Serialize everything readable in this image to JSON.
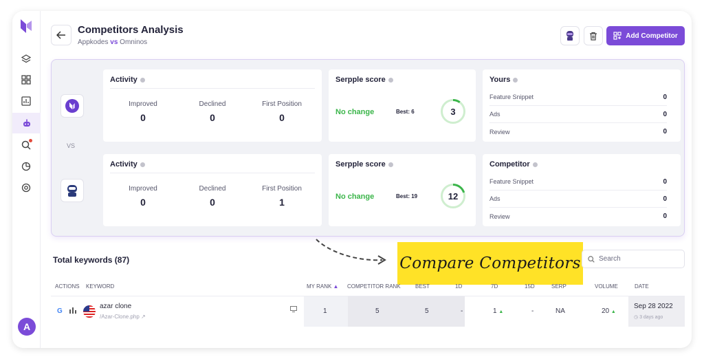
{
  "header": {
    "title": "Competitors Analysis",
    "subtitle_left": "Appkodes",
    "subtitle_vs": "vs",
    "subtitle_right": "Omninos",
    "add_button_label": "Add Competitor"
  },
  "sidebar": {
    "avatar_letter": "A",
    "items": [
      "layers-icon",
      "grid-icon",
      "report-icon",
      "robot-icon",
      "search-icon",
      "chart-icon",
      "settings-icon"
    ]
  },
  "comparison": {
    "vs_label": "VS",
    "top": {
      "activity": {
        "title": "Activity",
        "stats": [
          {
            "label": "Improved",
            "value": "0"
          },
          {
            "label": "Declined",
            "value": "0"
          },
          {
            "label": "First Position",
            "value": "0"
          }
        ]
      },
      "serpple": {
        "title": "Serpple score",
        "status": "No change",
        "best": "Best: 6",
        "score": "3",
        "progress": 0.1
      },
      "details": {
        "title": "Yours",
        "rows": [
          {
            "label": "Feature Snippet",
            "value": "0"
          },
          {
            "label": "Ads",
            "value": "0"
          },
          {
            "label": "Review",
            "value": "0"
          }
        ]
      }
    },
    "bottom": {
      "activity": {
        "title": "Activity",
        "stats": [
          {
            "label": "Improved",
            "value": "0"
          },
          {
            "label": "Declined",
            "value": "0"
          },
          {
            "label": "First Position",
            "value": "1"
          }
        ]
      },
      "serpple": {
        "title": "Serpple score",
        "status": "No change",
        "best": "Best: 19",
        "score": "12",
        "progress": 0.2
      },
      "details": {
        "title": "Competitor",
        "rows": [
          {
            "label": "Feature Snippet",
            "value": "0"
          },
          {
            "label": "Ads",
            "value": "0"
          },
          {
            "label": "Review",
            "value": "0"
          }
        ]
      }
    }
  },
  "keywords": {
    "total_label": "Total keywords (87)",
    "promo_text": "Compare Competitors",
    "search_placeholder": "Search",
    "columns": [
      "ACTIONS",
      "KEYWORD",
      "MY RANK",
      "COMPETITOR RANK",
      "BEST",
      "1D",
      "7D",
      "15D",
      "SERP",
      "VOLUME",
      "DATE"
    ],
    "rows": [
      {
        "keyword": "azar clone",
        "url": "/Azar-Clone.php",
        "my_rank": "1",
        "competitor_rank": "5",
        "best": "5",
        "d1": "-",
        "d7": "1",
        "d15": "-",
        "serp": "NA",
        "volume": "20",
        "date": "Sep 28 2022",
        "date_ago": "3 days ago"
      }
    ]
  },
  "colors": {
    "accent": "#7b4bd8",
    "positive": "#3bb54a",
    "promo": "#ffe227"
  }
}
